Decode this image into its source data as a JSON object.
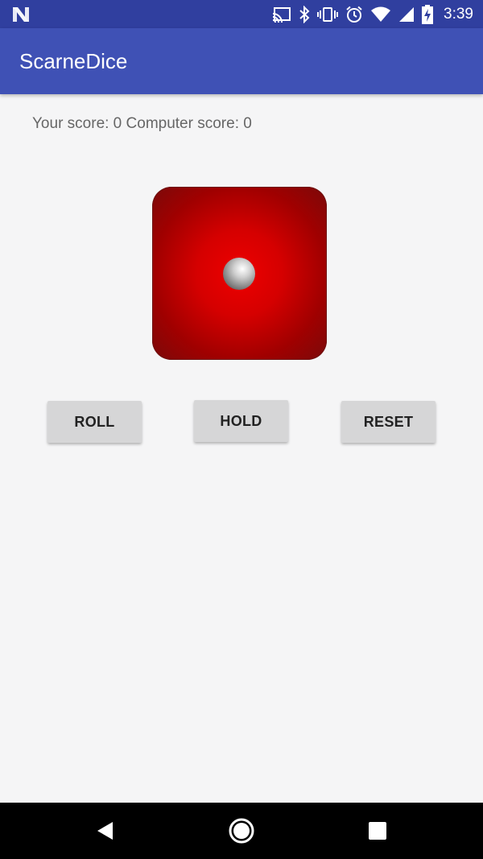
{
  "status_bar": {
    "time": "3:39",
    "icons": [
      "notification-n-icon",
      "cast-icon",
      "bluetooth-icon",
      "vibrate-icon",
      "alarm-icon",
      "wifi-icon",
      "signal-icon",
      "battery-charging-icon"
    ]
  },
  "app_bar": {
    "title": "ScarneDice",
    "color": "#3f51b5"
  },
  "score": {
    "text": "Your score: 0 Computer score: 0"
  },
  "dice": {
    "face_value": 1,
    "color": "#d50000"
  },
  "buttons": {
    "roll": "ROLL",
    "hold": "HOLD",
    "reset": "RESET"
  },
  "nav_bar": {
    "icons": [
      "back-icon",
      "home-icon",
      "recents-icon"
    ]
  }
}
